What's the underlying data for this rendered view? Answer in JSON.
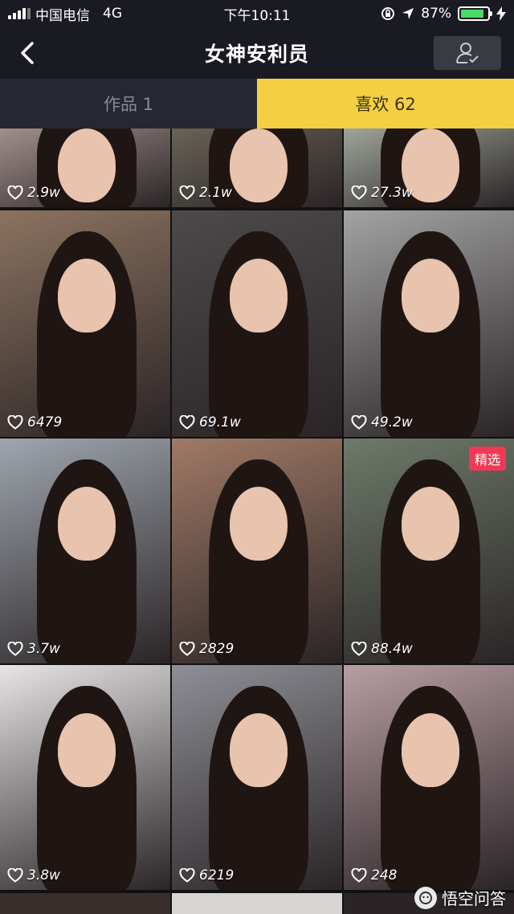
{
  "status": {
    "carrier": "中国电信",
    "network": "4G",
    "time": "下午10:11",
    "battery": "87%",
    "battery_level": 0.87
  },
  "nav": {
    "title": "女神安利员",
    "back_icon": "chevron-left-icon",
    "profile_icon": "user-check-icon"
  },
  "tabs": [
    {
      "label": "作品 1",
      "active": false
    },
    {
      "label": "喜欢 62",
      "active": true
    }
  ],
  "grid": {
    "badge_label": "精选",
    "items": [
      {
        "likes": "2.9w",
        "bg": "#c9b4ae"
      },
      {
        "likes": "2.1w",
        "bg": "#7d7868"
      },
      {
        "likes": "27.3w",
        "bg": "#c7d0c3"
      },
      {
        "likes": "6479",
        "bg": "#8c7360"
      },
      {
        "likes": "69.1w",
        "bg": "#4d4a4a"
      },
      {
        "likes": "49.2w",
        "bg": "#a3a3a3"
      },
      {
        "likes": "3.7w",
        "bg": "#9fa6ae"
      },
      {
        "likes": "2829",
        "bg": "#a07a66"
      },
      {
        "likes": "88.4w",
        "bg": "#6e7a6a"
      },
      {
        "likes": "3.8w",
        "bg": "#e6e4e4"
      },
      {
        "likes": "6219",
        "bg": "#8e8f96"
      },
      {
        "likes": "248",
        "bg": "#b89ea3"
      }
    ]
  },
  "watermark": {
    "text": "悟空问答"
  }
}
